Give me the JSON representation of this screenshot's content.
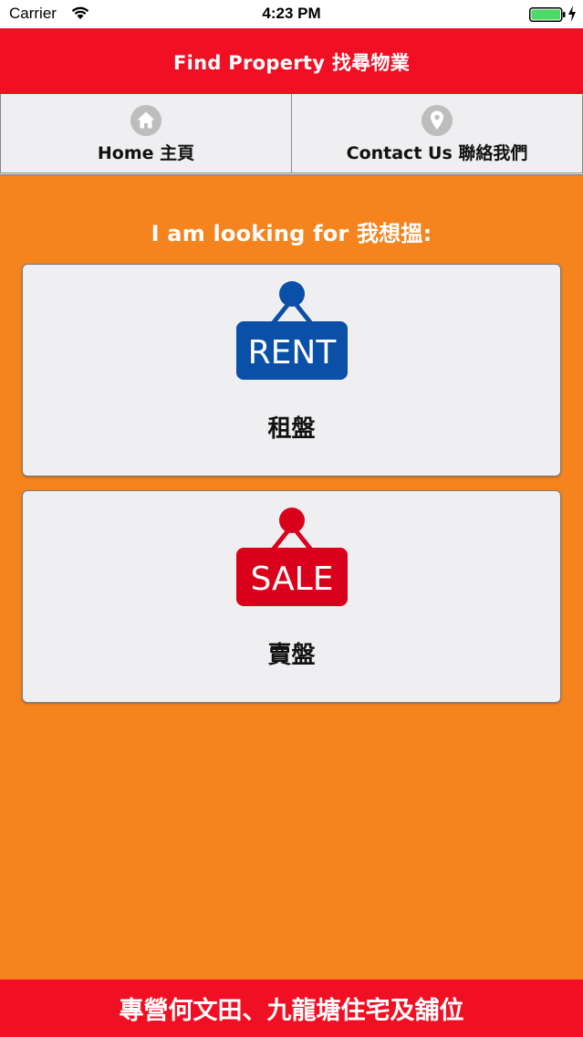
{
  "status_bar": {
    "carrier": "Carrier",
    "time": "4:23 PM",
    "wifi_icon": "wifi-icon",
    "battery_icon": "battery-charging-icon",
    "battery_color": "#4cd964"
  },
  "nav_bar": {
    "title": "Find Property 找尋物業",
    "background": "#f10f24"
  },
  "tabs": [
    {
      "label": "Home 主頁",
      "icon": "home-icon"
    },
    {
      "label": "Contact Us 聯絡我們",
      "icon": "location-pin-icon"
    }
  ],
  "main": {
    "lead_text": "I am looking for 我想搵:",
    "background": "#f5831e",
    "options": [
      {
        "sign_text": "RENT",
        "label": "租盤",
        "sign_color": "#0a4fa8",
        "icon": "rent-sign-icon"
      },
      {
        "sign_text": "SALE",
        "label": "賣盤",
        "sign_color": "#d9001b",
        "icon": "sale-sign-icon"
      }
    ]
  },
  "footer": {
    "text": "專營何文田、九龍塘住宅及舖位"
  }
}
